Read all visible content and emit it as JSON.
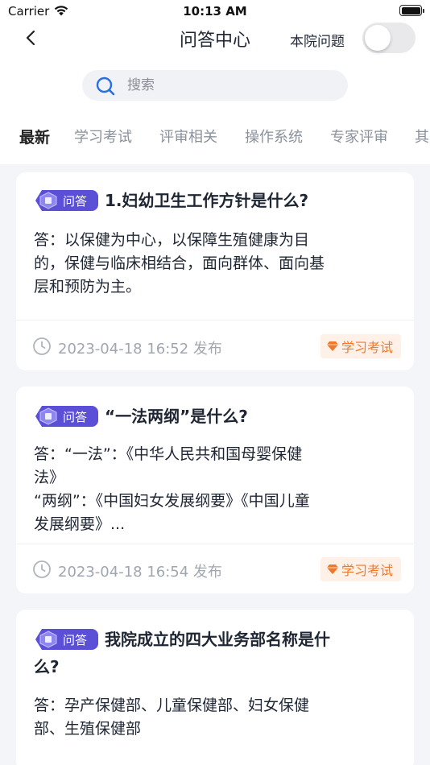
{
  "status_bar": {
    "carrier": "Carrier",
    "time": "10:13 AM"
  },
  "nav": {
    "title": "问答中心",
    "toggle_label": "本院问题",
    "toggle_on": false
  },
  "search": {
    "placeholder": "搜索"
  },
  "tabs": [
    {
      "label": "最新",
      "active": true
    },
    {
      "label": "学习考试",
      "active": false
    },
    {
      "label": "评审相关",
      "active": false
    },
    {
      "label": "操作系统",
      "active": false
    },
    {
      "label": "专家评审",
      "active": false
    },
    {
      "label": "其",
      "active": false
    }
  ],
  "cards": [
    {
      "badge": "问答",
      "title": "1.妇幼卫生工作方针是什么?",
      "answer_lines": [
        "答：以保健为中心，以保障生殖健康为目",
        "的，保健与临床相结合，面向群体、面向基",
        "层和预防为主。"
      ],
      "date": "2023-04-18 16:52 发布",
      "tag": "学习考试"
    },
    {
      "badge": "问答",
      "title": "“一法两纲”是什么?",
      "answer_lines": [
        "答：“一法”：《中华人民共和国母婴保健",
        "法》",
        "“两纲”：《中国妇女发展纲要》《中国儿童",
        "发展纲要》..."
      ],
      "date": "2023-04-18 16:54 发布",
      "tag": "学习考试"
    },
    {
      "badge": "问答",
      "title_lines": [
        "我院成立的四大业务部名称是什",
        "么?"
      ],
      "answer_lines": [
        "答：孕产保健部、儿童保健部、妇女保健",
        "部、生殖保健部"
      ]
    }
  ],
  "colors": {
    "accent": "#5a4fd6",
    "tag_text": "#f0782a",
    "tag_bg": "#fff1e8",
    "muted": "#a0a6b0"
  },
  "icons": {
    "back": "chevron-left-icon",
    "search": "search-icon",
    "clock": "clock-icon",
    "tag": "diamond-icon",
    "wifi": "wifi-icon",
    "battery": "battery-icon"
  }
}
